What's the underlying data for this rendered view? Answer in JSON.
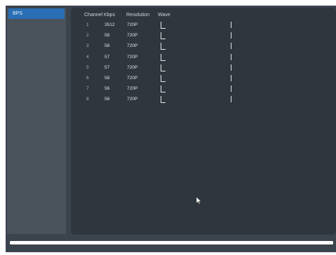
{
  "sidebar": {
    "items": [
      {
        "label": "BPS",
        "selected": true
      }
    ]
  },
  "table": {
    "headers": {
      "channel": "Channel",
      "kbps": "Kbps",
      "resolution": "Resolution",
      "wave": "Wave"
    },
    "rows": [
      {
        "channel": "1",
        "kbps": "3512",
        "resolution": "720P"
      },
      {
        "channel": "2",
        "kbps": "58",
        "resolution": "720P"
      },
      {
        "channel": "3",
        "kbps": "58",
        "resolution": "720P"
      },
      {
        "channel": "4",
        "kbps": "57",
        "resolution": "720P"
      },
      {
        "channel": "5",
        "kbps": "57",
        "resolution": "720P"
      },
      {
        "channel": "6",
        "kbps": "58",
        "resolution": "720P"
      },
      {
        "channel": "7",
        "kbps": "56",
        "resolution": "720P"
      },
      {
        "channel": "8",
        "kbps": "58",
        "resolution": "720P"
      }
    ]
  },
  "colors": {
    "accent": "#2a6fb5",
    "panel": "#2f363d",
    "background": "#3b434c"
  },
  "icons": {
    "cursor": "mouse-pointer-icon"
  }
}
